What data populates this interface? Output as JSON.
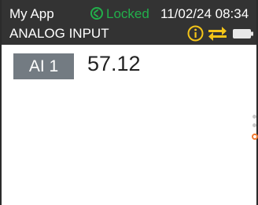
{
  "status_bar": {
    "app_name": "My App",
    "lock_status": "Locked",
    "lock_color": "#22b04b",
    "datetime": "11/02/24 08:34",
    "screen_title": "ANALOG INPUT",
    "icons": [
      "info-icon",
      "swap-icon",
      "battery-icon"
    ],
    "icon_color": "#f5c518"
  },
  "channel": {
    "label": "AI 1",
    "value": "57.12"
  },
  "pager": {
    "page_count": 3,
    "active_page": 3,
    "active_color": "#f07a32"
  }
}
